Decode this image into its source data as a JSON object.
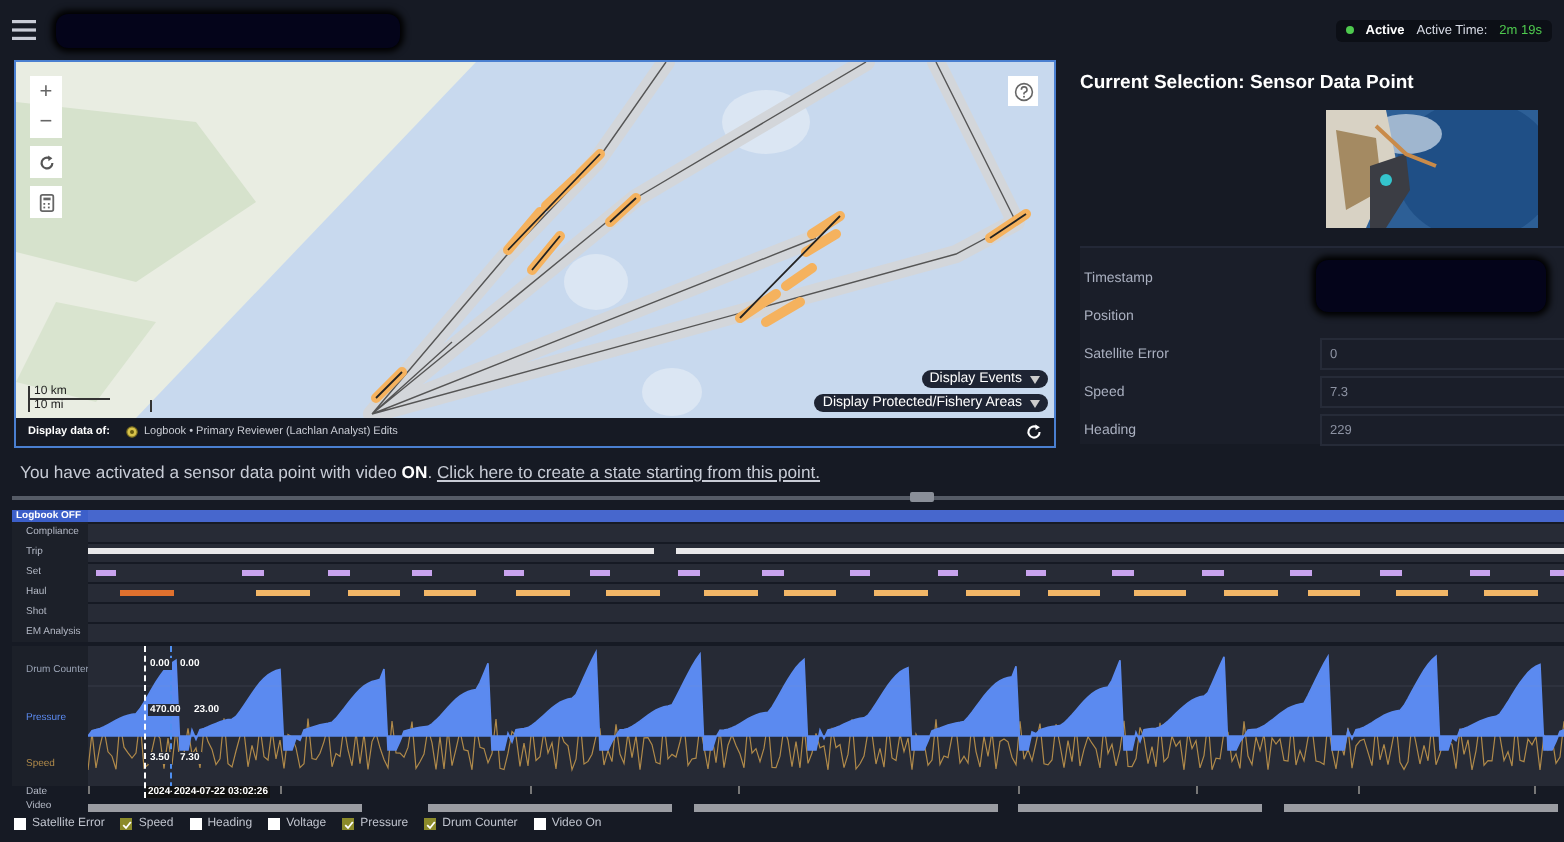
{
  "header": {
    "status": "Active",
    "active_time_label": "Active Time:",
    "active_time": "2m 19s"
  },
  "map": {
    "zoom_in": "+",
    "zoom_out": "−",
    "scale": [
      "10 km",
      "10 mi"
    ],
    "overlay_buttons": [
      "Display Events",
      "Display Protected/Fishery Areas"
    ],
    "display_data_label": "Display data of:",
    "display_data_value": "Logbook • Primary Reviewer (Lachlan Analyst) Edits"
  },
  "selection": {
    "title": "Current Selection: Sensor Data Point",
    "fields": [
      {
        "label": "Timestamp"
      },
      {
        "label": "Position"
      },
      {
        "label": "Satellite Error",
        "value": "0"
      },
      {
        "label": "Speed",
        "value": "7.3"
      },
      {
        "label": "Heading",
        "value": "229"
      }
    ]
  },
  "message": {
    "text": "You have activated a sensor data point with video **ON**.",
    "link": "Click here to create a state starting from this point."
  },
  "timeline": {
    "toggle": "Logbook OFF",
    "rows": [
      {
        "label": "Compliance",
        "kind": "empty"
      },
      {
        "label": "Trip",
        "kind": "trip"
      },
      {
        "label": "Set",
        "kind": "set"
      },
      {
        "label": "Haul",
        "kind": "haul",
        "events": [
          {
            "selected": true
          },
          {
            "selected": false
          },
          {
            "selected": false
          },
          {
            "selected": false
          },
          {
            "selected": false
          },
          {
            "selected": false
          },
          {
            "selected": false
          },
          {
            "selected": false
          },
          {
            "selected": false
          },
          {
            "selected": false
          },
          {
            "selected": false
          },
          {
            "selected": false
          },
          {
            "selected": false
          },
          {
            "selected": false
          },
          {
            "selected": false
          },
          {
            "selected": false
          }
        ]
      },
      {
        "label": "Shot",
        "kind": "empty"
      },
      {
        "label": "EM Analysis",
        "kind": "empty"
      }
    ]
  },
  "sensor_chart": {
    "series": [
      {
        "name": "Drum Counter",
        "color": "#9aa3b5",
        "readouts": [
          "0.00",
          "0.00"
        ]
      },
      {
        "name": "Pressure",
        "color": "#5b8af0",
        "readouts": [
          "470.00",
          "23.00"
        ]
      },
      {
        "name": "Speed",
        "color": "#b08a4a",
        "readouts": [
          "3.50",
          "7.30"
        ]
      }
    ],
    "cursor_dates": [
      "2024-",
      "2024-07-22 03:02:26"
    ],
    "date_label": "Date",
    "video_label": "Video"
  },
  "checkboxes": [
    {
      "label": "Satellite Error",
      "checked": false
    },
    {
      "label": "Speed",
      "checked": true
    },
    {
      "label": "Heading",
      "checked": false
    },
    {
      "label": "Voltage",
      "checked": false
    },
    {
      "label": "Pressure",
      "checked": true
    },
    {
      "label": "Drum Counter",
      "checked": true
    },
    {
      "label": "Video On",
      "checked": false
    }
  ]
}
